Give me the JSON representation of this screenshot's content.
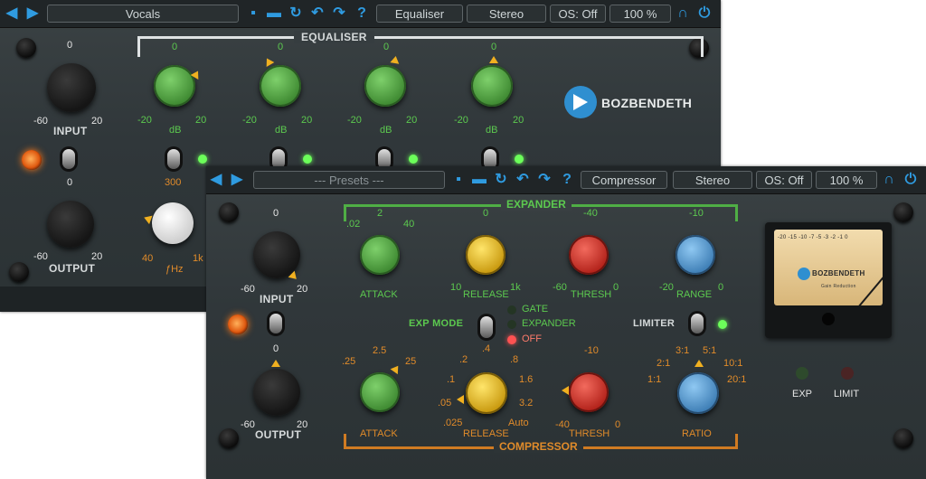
{
  "back_window": {
    "toolbar": {
      "preset": "Vocals",
      "mode": "Equaliser",
      "channel": "Stereo",
      "oversampling": "OS: Off",
      "zoom": "100 %",
      "help": "?"
    },
    "section_title": "EQUALISER",
    "brand": "BOZBENDETH",
    "input": {
      "label": "INPUT",
      "min": "-60",
      "max": "20",
      "center": "0"
    },
    "output": {
      "label": "OUTPUT",
      "min": "-60",
      "max": "20",
      "center": "0"
    },
    "eq_bands": [
      {
        "center": "0",
        "min": "-20",
        "max": "20",
        "unit": "dB"
      },
      {
        "center": "0",
        "min": "-20",
        "max": "20",
        "unit": "dB"
      },
      {
        "center": "0",
        "min": "-20",
        "max": "20",
        "unit": "dB"
      },
      {
        "center": "0",
        "min": "-20",
        "max": "20",
        "unit": "dB"
      }
    ],
    "freq": {
      "top": "300",
      "min": "40",
      "max": "1k",
      "label": "ƒHz"
    }
  },
  "front_window": {
    "toolbar": {
      "preset": "--- Presets ---",
      "mode": "Compressor",
      "channel": "Stereo",
      "oversampling": "OS: Off",
      "zoom": "100 %",
      "help": "?"
    },
    "expander_title": "EXPANDER",
    "compressor_title": "COMPRESSOR",
    "input": {
      "label": "INPUT",
      "min": "-60",
      "max": "20",
      "center": "0"
    },
    "output": {
      "label": "OUTPUT",
      "min": "-60",
      "max": "20",
      "center": "0"
    },
    "expander": {
      "attack": {
        "label": "ATTACK",
        "left": ".02",
        "center": "2",
        "right": "40"
      },
      "release": {
        "label": "RELEASE",
        "center": "0",
        "left": "10",
        "right": "1k"
      },
      "thresh": {
        "label": "THRESH",
        "center": "-40",
        "left": "-60",
        "right": "0"
      },
      "range": {
        "label": "RANGE",
        "center": "-10",
        "left": "-20",
        "right": "0"
      }
    },
    "exp_mode": {
      "label": "EXP MODE",
      "options": [
        "GATE",
        "EXPANDER",
        "OFF"
      ]
    },
    "limiter": "LIMITER",
    "compressor": {
      "attack": {
        "label": "ATTACK",
        "left": ".25",
        "center": "2.5",
        "right": "25"
      },
      "release": {
        "label": "RELEASE",
        "v1": ".2",
        "v2": ".4",
        "v3": ".8",
        "v4": ".1",
        "v5": "1.6",
        "v6": ".05",
        "v7": "3.2",
        "v8": ".025",
        "v9": "Auto"
      },
      "thresh": {
        "label": "THRESH",
        "center": "-10",
        "left": "-40",
        "right": "0"
      },
      "ratio": {
        "label": "RATIO",
        "r1": "3:1",
        "r2": "5:1",
        "r3": "2:1",
        "r4": "10:1",
        "r5": "1:1",
        "r6": "20:1"
      }
    },
    "meter_brand": "BOZBENDETH",
    "meter_sub": "Gain Reduction",
    "meter_scale": [
      "-20",
      "-15",
      "-10",
      "-7",
      "-5",
      "-3",
      "-2",
      "-1",
      "0"
    ],
    "exp_led": "EXP",
    "limit_led": "LIMIT"
  }
}
